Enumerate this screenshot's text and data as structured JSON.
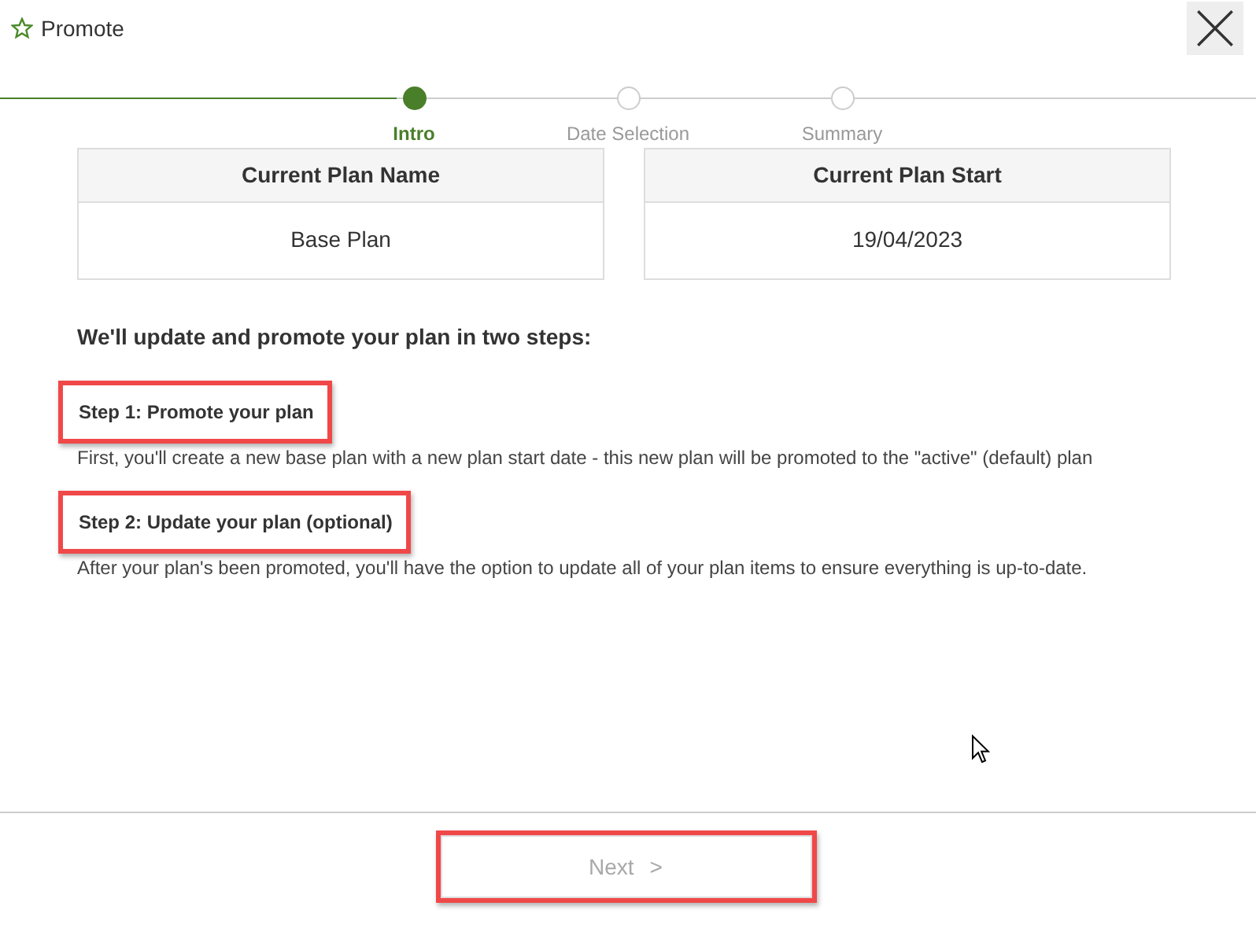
{
  "dialog": {
    "title": "Promote"
  },
  "stepper": [
    {
      "label": "Intro",
      "selected": true
    },
    {
      "label": "Date Selection",
      "selected": false
    },
    {
      "label": "Summary",
      "selected": false
    }
  ],
  "plan_cards": [
    {
      "header": "Current Plan Name",
      "value": "Base Plan"
    },
    {
      "header": "Current Plan Start",
      "value": "19/04/2023"
    }
  ],
  "intro_heading": "We'll update and promote your plan in two steps:",
  "steps": [
    {
      "title": "Step 1: Promote your plan",
      "highlighted": true,
      "description": "First, you'll create a new base plan with a new plan start date - this new plan will be promoted to the \"active\" (default) plan"
    },
    {
      "title": "Step 2: Update your plan (optional)",
      "highlighted": true,
      "description": "After your plan's been promoted, you'll have the option to update all of your plan items to ensure everything is up-to-date."
    }
  ],
  "next_button": {
    "label": "Next",
    "icon": ">",
    "disabled": true,
    "highlighted": true
  }
}
